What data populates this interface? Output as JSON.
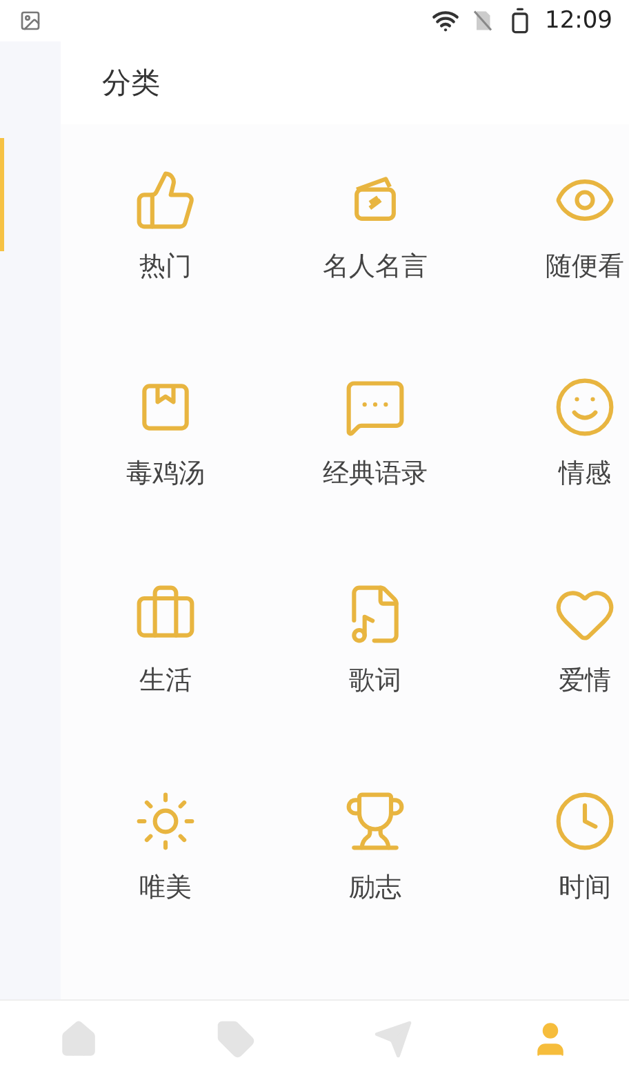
{
  "status_bar": {
    "time": "12:09"
  },
  "header": {
    "title": "分类"
  },
  "sidebar": {
    "items": [
      {
        "selected": true
      }
    ]
  },
  "categories": [
    {
      "label": "热门"
    },
    {
      "label": "名人名言"
    },
    {
      "label": "随便看"
    },
    {
      "label": "毒鸡汤"
    },
    {
      "label": "经典语录"
    },
    {
      "label": "情感"
    },
    {
      "label": "生活"
    },
    {
      "label": "歌词"
    },
    {
      "label": "爱情"
    },
    {
      "label": "唯美"
    },
    {
      "label": "励志"
    },
    {
      "label": "时间"
    }
  ],
  "bottom_nav": [
    {
      "selected": false
    },
    {
      "selected": false
    },
    {
      "selected": false
    },
    {
      "selected": true
    }
  ]
}
